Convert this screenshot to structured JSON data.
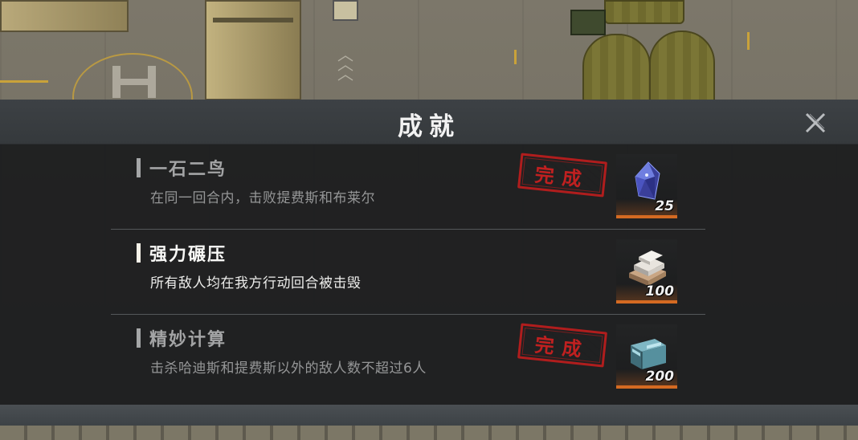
{
  "panel": {
    "title": "成就",
    "close_icon": "close-icon"
  },
  "achievements": [
    {
      "name": "一石二鸟",
      "description": "在同一回合内，击败提费斯和布莱尔",
      "completed": true,
      "stamp_label": "完成",
      "reward": {
        "icon": "crystal-gem-icon",
        "count": "25"
      }
    },
    {
      "name": "强力碾压",
      "description": "所有敌人均在我方行动回合被击毁",
      "completed": false,
      "reward": {
        "icon": "silver-ingot-icon",
        "count": "100"
      }
    },
    {
      "name": "精妙计算",
      "description": "击杀哈迪斯和提费斯以外的敌人数不超过6人",
      "completed": true,
      "stamp_label": "完成",
      "reward": {
        "icon": "supply-crate-icon",
        "count": "200"
      }
    }
  ],
  "colors": {
    "panel_bg": "#1e1f20",
    "header_bg": "#3d4145",
    "stamp_red": "#c02020",
    "reward_accent": "#d46a22"
  }
}
